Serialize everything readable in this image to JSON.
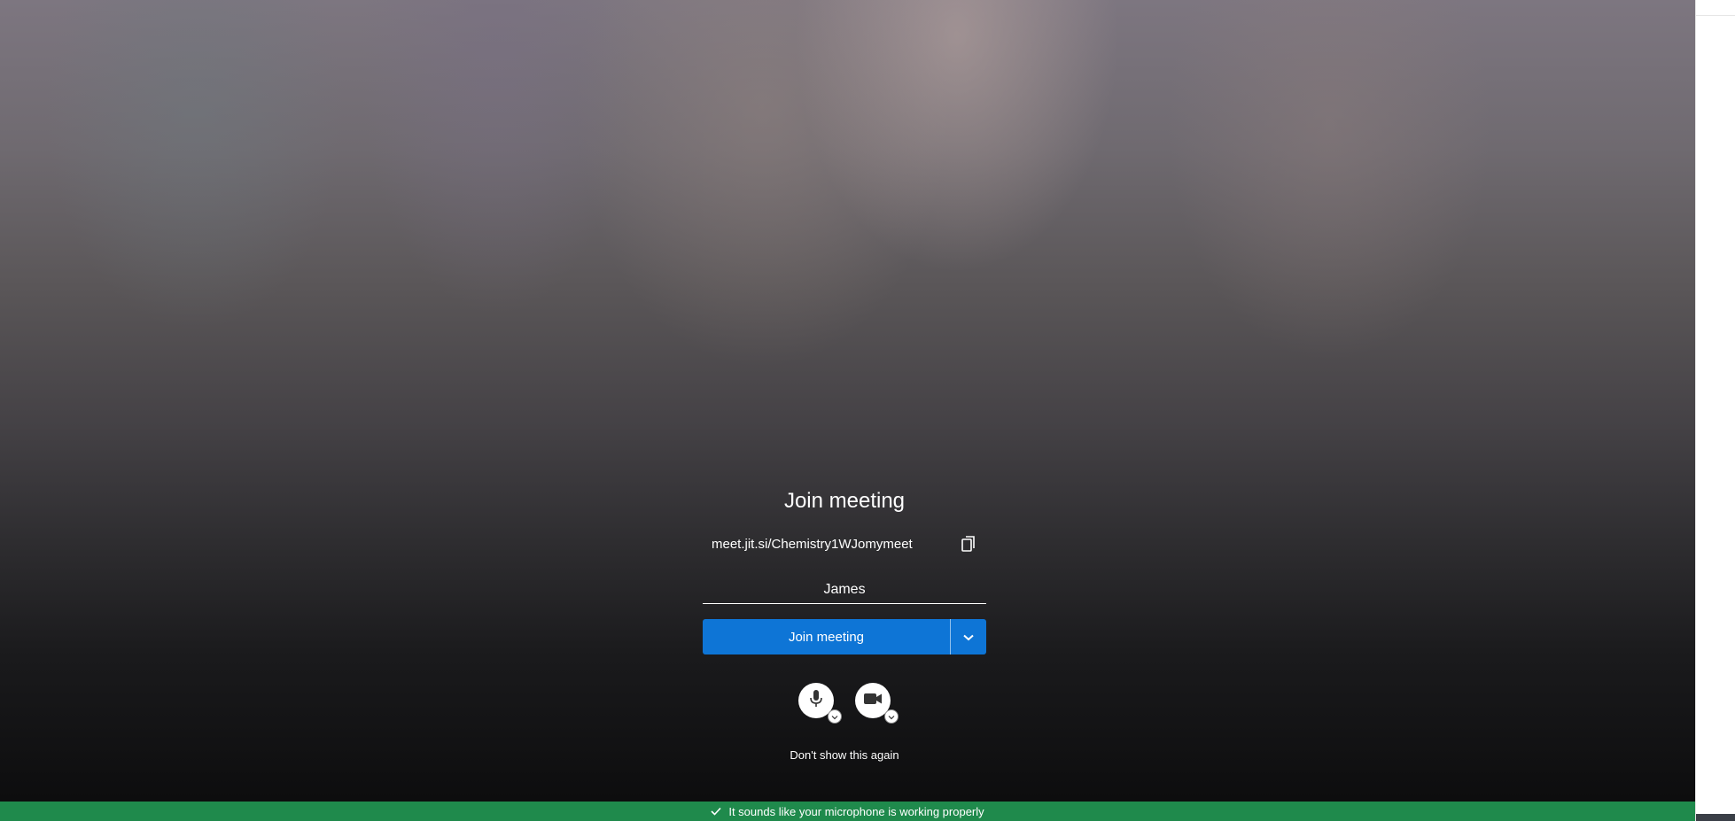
{
  "prejoin": {
    "title": "Join meeting",
    "meeting_url": "meet.jit.si/Chemistry1WJomymeet",
    "copy_icon": "copy-icon",
    "name_value": "James",
    "join_button_label": "Join meeting",
    "join_options_icon": "chevron-down-icon",
    "microphone_icon": "microphone-icon",
    "camera_icon": "camera-icon",
    "dont_show_label": "Don't show this again"
  },
  "notification": {
    "icon": "check-icon",
    "message": "It sounds like your microphone is working properly",
    "color": "#1f8a4c"
  },
  "colors": {
    "join_button": "#0e75d6"
  }
}
